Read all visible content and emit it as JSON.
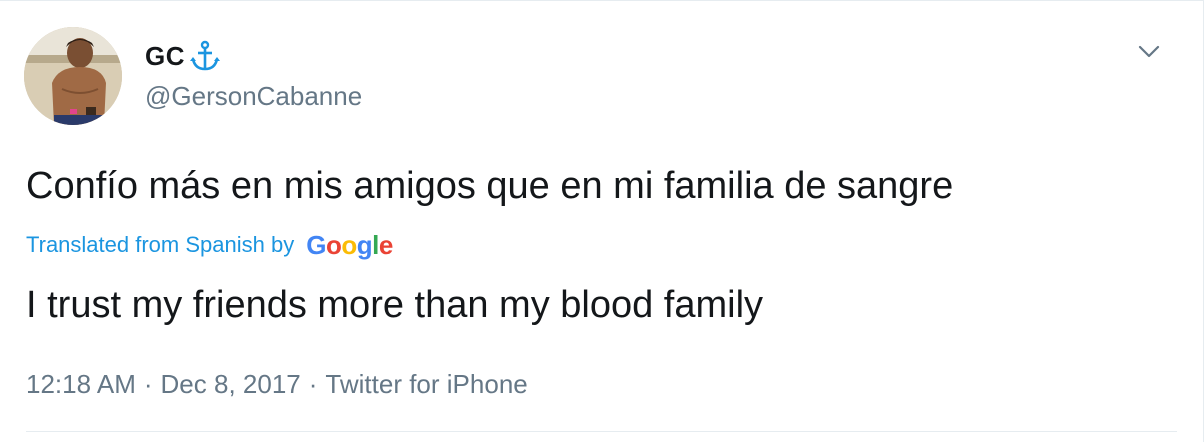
{
  "user": {
    "display_name": "GC",
    "handle": "@GersonCabanne",
    "name_emoji_icon": "anchor-icon",
    "avatar_icon": "profile-photo"
  },
  "tweet": {
    "original_text": "Confío más en mis amigos que en mi familia de sangre",
    "translation_label": "Translated from Spanish by",
    "translation_provider": "Google",
    "translated_text": "I trust my friends more than my blood family",
    "time": "12:18 AM",
    "date": "Dec 8, 2017",
    "source": "Twitter for iPhone",
    "separator": "·"
  },
  "colors": {
    "text": "#14171a",
    "secondary": "#657786",
    "link": "#1b95e0",
    "anchor": "#1b95e0",
    "divider": "#e6ecf0",
    "google_blue": "#4285f4",
    "google_red": "#ea4335",
    "google_yellow": "#fbbc05",
    "google_green": "#34a853"
  }
}
